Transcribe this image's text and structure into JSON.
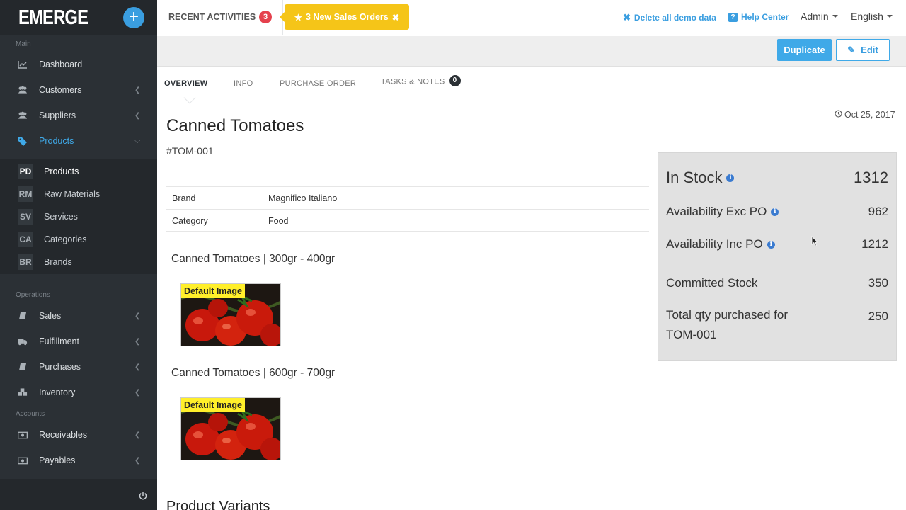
{
  "app": {
    "logo": "EMERGE",
    "add_symbol": "+"
  },
  "sidebar": {
    "sections": {
      "main": "Main",
      "operations": "Operations",
      "accounts": "Accounts"
    },
    "main_items": [
      {
        "label": "Dashboard",
        "icon": "chart-line-icon"
      },
      {
        "label": "Customers",
        "icon": "users-icon"
      },
      {
        "label": "Suppliers",
        "icon": "users-icon"
      },
      {
        "label": "Products",
        "icon": "tags-icon",
        "active": true
      }
    ],
    "product_subitems": [
      {
        "abbr": "PD",
        "label": "Products",
        "active": true
      },
      {
        "abbr": "RM",
        "label": "Raw Materials"
      },
      {
        "abbr": "SV",
        "label": "Services"
      },
      {
        "abbr": "CA",
        "label": "Categories"
      },
      {
        "abbr": "BR",
        "label": "Brands"
      }
    ],
    "operations_items": [
      {
        "label": "Sales",
        "icon": "book-icon"
      },
      {
        "label": "Fulfillment",
        "icon": "truck-icon"
      },
      {
        "label": "Purchases",
        "icon": "book-icon"
      },
      {
        "label": "Inventory",
        "icon": "cubes-icon"
      }
    ],
    "accounts_items": [
      {
        "label": "Receivables",
        "icon": "money-icon"
      },
      {
        "label": "Payables",
        "icon": "money-icon"
      }
    ]
  },
  "topbar": {
    "recent_label": "RECENT ACTIVITIES",
    "recent_count": "3",
    "notification": "3 New Sales Orders",
    "delete_demo": "Delete all demo data",
    "help_center": "Help Center",
    "user": "Admin",
    "language": "English"
  },
  "actions": {
    "duplicate": "Duplicate",
    "edit": "Edit"
  },
  "tabs": [
    {
      "label": "OVERVIEW",
      "active": true
    },
    {
      "label": "INFO"
    },
    {
      "label": "PURCHASE ORDER"
    },
    {
      "label": "TASKS & NOTES",
      "badge": "0"
    }
  ],
  "product": {
    "title": "Canned Tomatoes",
    "sku": "#TOM-001",
    "date": "Oct 25, 2017",
    "attributes": [
      {
        "key": "Brand",
        "value": "Magnifico Italiano"
      },
      {
        "key": "Category",
        "value": "Food"
      }
    ],
    "variants": [
      {
        "title": "Canned Tomatoes | 300gr - 400gr",
        "image_label": "Default Image"
      },
      {
        "title": "Canned Tomatoes | 600gr - 700gr",
        "image_label": "Default Image"
      }
    ],
    "variants_heading": "Product Variants"
  },
  "stock": {
    "in_stock": {
      "label": "In Stock",
      "value": "1312"
    },
    "avail_exc": {
      "label": "Availability Exc PO",
      "value": "962"
    },
    "avail_inc": {
      "label": "Availability Inc PO",
      "value": "1212"
    },
    "committed": {
      "label": "Committed Stock",
      "value": "350"
    },
    "total_purchased": {
      "label_line1": "Total qty purchased for",
      "label_line2": "TOM-001",
      "value": "250"
    }
  },
  "colors": {
    "accent": "#3fa9e8",
    "sidebar_bg": "#2b3035",
    "notification": "#f5c518",
    "badge_red": "#e5414d"
  }
}
